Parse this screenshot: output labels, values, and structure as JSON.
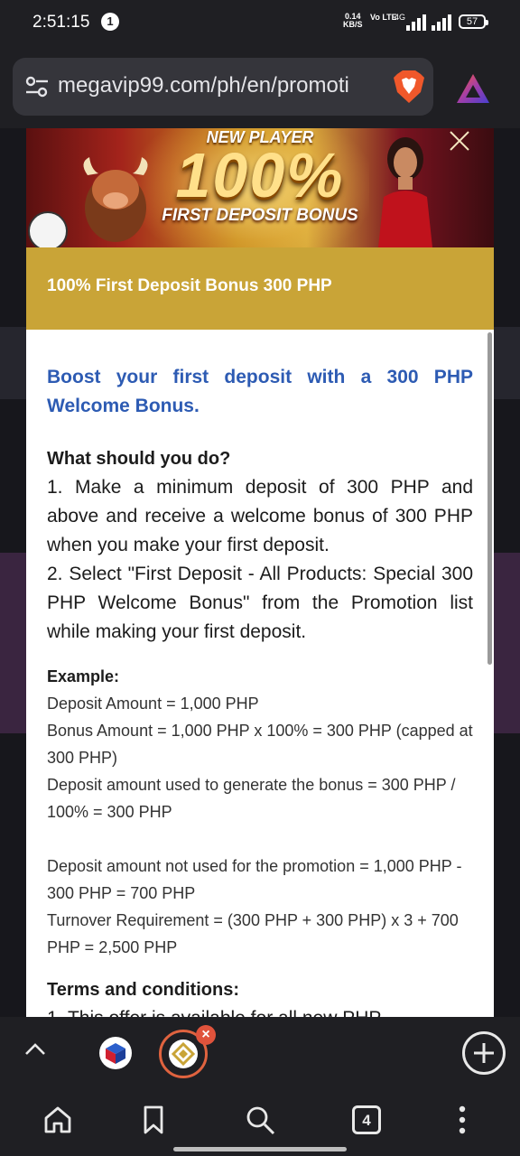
{
  "status_bar": {
    "time": "2:51:15",
    "notification_count": "1",
    "net_speed": "0.14",
    "net_unit": "KB/S",
    "volte": "Vo LTE",
    "network_type": "4G",
    "battery": "57"
  },
  "browser": {
    "url": "megavip99.com/ph/en/promoti",
    "open_tab_count": "4",
    "close_tab_label": "×"
  },
  "banner": {
    "line1": "NEW PLAYER",
    "line2": "100%",
    "line3": "FIRST DEPOSIT BONUS"
  },
  "promo": {
    "title": "100% First Deposit Bonus 300 PHP",
    "lead": "Boost your first deposit with a 300 PHP Welcome Bonus.",
    "what_heading": "What should you do?",
    "step1": "1. Make a minimum deposit of 300 PHP and above and receive a welcome bonus of 300 PHP when you make your first deposit.",
    "step2": "2. Select \"First Deposit - All Products: Special 300 PHP Welcome Bonus\" from the Promotion list while making your first deposit.",
    "example_heading": "Example:",
    "example_lines": [
      "Deposit Amount = 1,000 PHP",
      "Bonus Amount = 1,000 PHP x 100% = 300 PHP (capped at 300 PHP)",
      "Deposit amount used to generate the bonus = 300 PHP / 100% = 300 PHP",
      "Deposit amount not used for the promotion = 1,000 PHP - 300 PHP = 700 PHP",
      "Turnover Requirement = (300 PHP + 300 PHP) x 3 + 700 PHP = 2,500 PHP"
    ],
    "terms_heading": "Terms and conditions:",
    "terms_first": "1. This offer is available for all new PHP"
  },
  "colors": {
    "accent_gold": "#c9a437",
    "lead_blue": "#2d5bb3",
    "tab_ring": "#e0633f"
  }
}
